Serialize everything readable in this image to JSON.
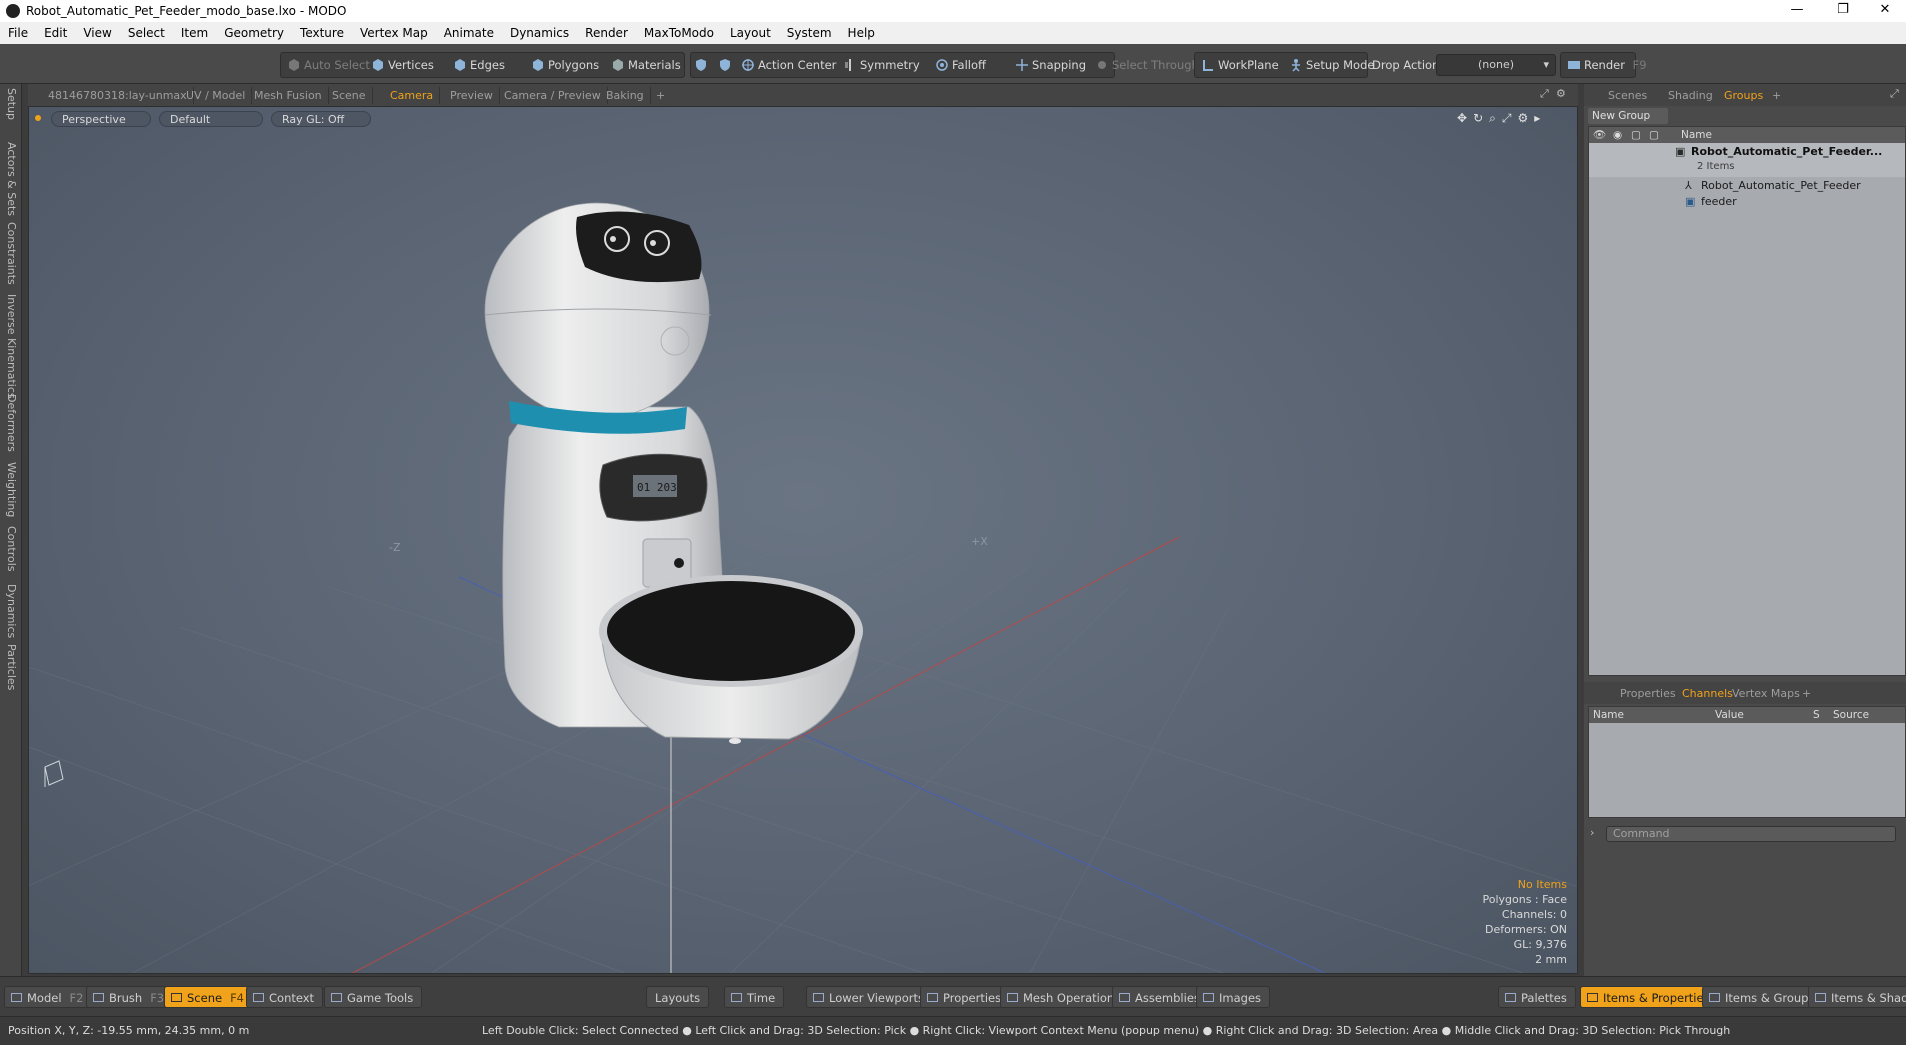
{
  "window": {
    "title": "Robot_Automatic_Pet_Feeder_modo_base.lxo - MODO",
    "minimize": "—",
    "restore": "❐",
    "close": "✕"
  },
  "menu": [
    "File",
    "Edit",
    "View",
    "Select",
    "Item",
    "Geometry",
    "Texture",
    "Vertex Map",
    "Animate",
    "Dynamics",
    "Render",
    "MaxToModo",
    "Layout",
    "System",
    "Help"
  ],
  "toolbar": {
    "auto_select": "Auto Select",
    "vertices": "Vertices",
    "edges": "Edges",
    "polygons": "Polygons",
    "materials": "Materials",
    "action_center": "Action Center",
    "symmetry": "Symmetry",
    "falloff": "Falloff",
    "snapping": "Snapping",
    "select_through": "Select Through",
    "workplane": "WorkPlane",
    "setup_mode": "Setup Mode",
    "drop_action": "Drop Action",
    "drop_action_value": "(none)",
    "render": "Render",
    "render_key": "F9"
  },
  "left_tabs": [
    "Setup",
    "Actors & Sets",
    "Constraints",
    "Inverse Kinematics",
    "Deformers",
    "Weighting",
    "Controls",
    "Dynamics",
    "Particles"
  ],
  "viewport_tabs": [
    "48146780318:lay-unmax",
    "UV / Model",
    "Mesh Fusion",
    "Scene",
    "Camera",
    "Preview",
    "Camera / Preview",
    "Baking",
    "+"
  ],
  "viewport": {
    "view_mode": "Perspective",
    "shading": "Default",
    "raygl": "Ray GL: Off",
    "axis_neg_z": "-Z",
    "axis_pos_x": "+X",
    "info": {
      "no_items": "No Items",
      "polygons": "Polygons : Face",
      "channels": "Channels: 0",
      "deformers": "Deformers: ON",
      "gl": "GL: 9,376",
      "scale": "2 mm"
    },
    "lcd_text": "01 203"
  },
  "right_panel": {
    "top_tabs": [
      "Scenes",
      "Shading",
      "Groups",
      "+"
    ],
    "new_group": "New Group",
    "name_header": "Name",
    "tree": [
      {
        "label": "Robot_Automatic_Pet_Feeder...",
        "sub": "2 Items"
      },
      {
        "label": "Robot_Automatic_Pet_Feeder"
      },
      {
        "label": "feeder"
      }
    ],
    "bottom_tabs": [
      "Properties",
      "Channels",
      "Vertex Maps",
      "+"
    ],
    "channel_headers": [
      "Name",
      "Value",
      "S",
      "Source"
    ],
    "command_placeholder": "Command"
  },
  "bottom": {
    "model": "Model",
    "model_key": "F2",
    "brush": "Brush",
    "brush_key": "F3",
    "scene": "Scene",
    "scene_key": "F4",
    "context": "Context",
    "game_tools": "Game Tools",
    "layouts": "Layouts",
    "time": "Time",
    "lower_viewports": "Lower Viewports",
    "properties": "Properties",
    "mesh_operations": "Mesh Operations",
    "assemblies": "Assemblies",
    "images": "Images",
    "palettes": "Palettes",
    "items_properties": "Items & Properties",
    "items_groups": "Items & Groups",
    "items_shading": "Items & Shading"
  },
  "status": {
    "position": "Position X, Y, Z:   -19.55 mm, 24.35 mm, 0 m",
    "hints": "Left Double Click: Select Connected ● Left Click and Drag: 3D Selection: Pick ● Right Click: Viewport Context Menu (popup menu) ● Right Click and Drag: 3D Selection: Area ● Middle Click and Drag: 3D Selection: Pick Through"
  },
  "colors": {
    "accent": "#f0a21a",
    "viewport_bg": "#5a6473",
    "collar": "#1f8fb0"
  }
}
